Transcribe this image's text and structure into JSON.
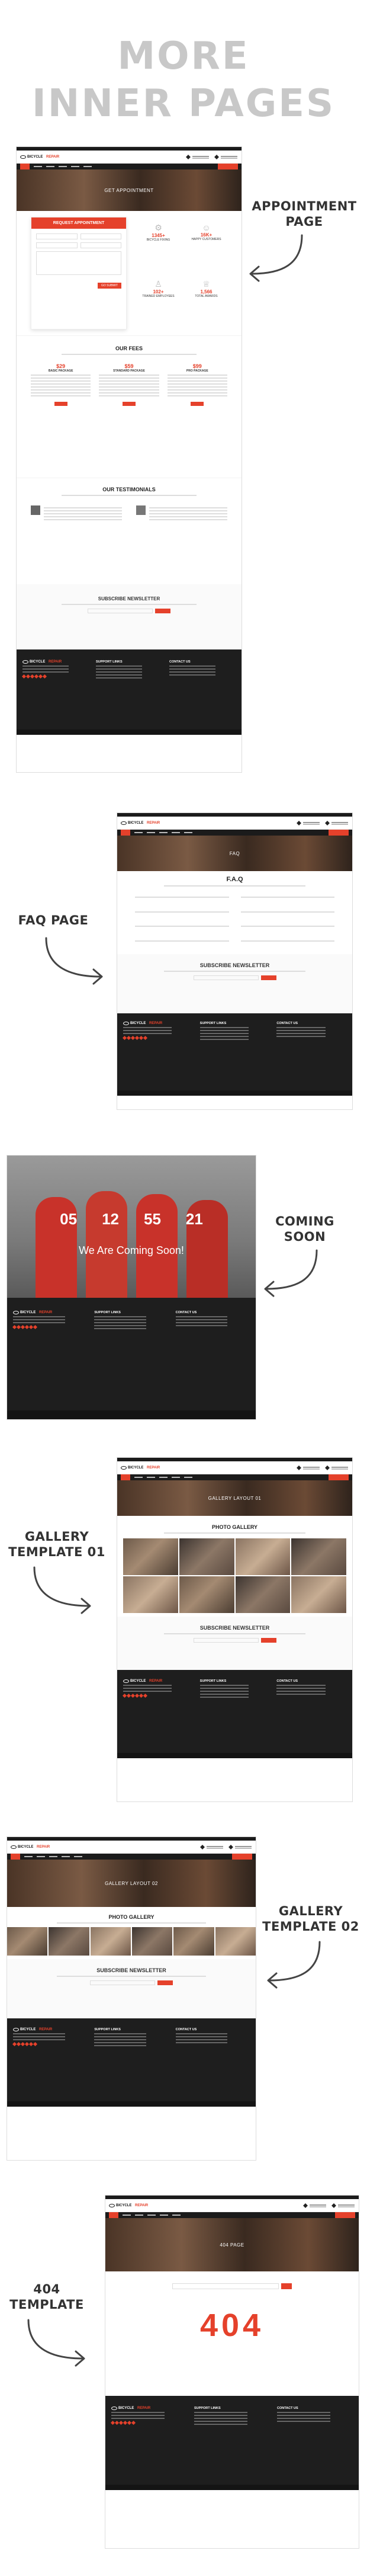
{
  "hero": {
    "line1": "MORE",
    "line2": "INNER PAGES"
  },
  "labels": {
    "appointment": [
      "APPOINTMENT",
      "PAGE"
    ],
    "faq": [
      "FAQ PAGE"
    ],
    "coming_soon": [
      "COMING",
      "SOON"
    ],
    "gallery1": [
      "GALLERY",
      "TEMPLATE 01"
    ],
    "gallery2": [
      "GALLERY",
      "TEMPLATE 02"
    ],
    "p404": [
      "404",
      "TEMPLATE"
    ]
  },
  "site": {
    "logo_a": "BICYCLE",
    "logo_b": "REPAIR"
  },
  "appointment_page": {
    "banner": "GET APPOINTMENT",
    "form_title": "REQUEST APPOINTMENT",
    "submit": "GO SUBMIT",
    "stats": [
      "BICYCLE FIXING",
      "HAPPY CUSTOMERS",
      "TRAINED EMPLOYEES",
      "TOTAL AWARDS"
    ],
    "stat_values": [
      "1345+",
      "16K+",
      "102+",
      "1,566"
    ],
    "fees_title": "OUR FEES",
    "fees_plans": [
      "BASIC PACKAGE",
      "STANDARD PACKAGE",
      "PRO PACKAGE"
    ],
    "fees_prices": [
      "$29",
      "$59",
      "$99"
    ],
    "testimonials_title": "OUR TESTIMONIALS",
    "newsletter_title": "SUBSCRIBE NEWSLETTER",
    "subscribe": "SUBSCRIBE"
  },
  "faq_page": {
    "banner": "FAQ",
    "title": "F.A.Q",
    "newsletter_title": "SUBSCRIBE NEWSLETTER",
    "subscribe": "SUBSCRIBE"
  },
  "coming_soon_page": {
    "counter": [
      "05",
      "12",
      "55",
      "21"
    ],
    "tagline": "We Are Coming Soon!"
  },
  "gallery1_page": {
    "banner": "GALLERY LAYOUT 01",
    "title": "PHOTO GALLERY",
    "newsletter_title": "SUBSCRIBE NEWSLETTER",
    "subscribe": "SUBSCRIBE"
  },
  "gallery2_page": {
    "banner": "GALLERY LAYOUT 02",
    "title": "PHOTO GALLERY",
    "newsletter_title": "SUBSCRIBE NEWSLETTER",
    "subscribe": "SUBSCRIBE"
  },
  "p404_page": {
    "banner": "404 PAGE",
    "code": "404"
  },
  "footer": {
    "support": "SUPPORT LINKS",
    "contact": "CONTACT US"
  },
  "colors": {
    "accent": "#e5412b",
    "dark": "#1e1e1e",
    "hero_text": "#c8c8c8"
  }
}
